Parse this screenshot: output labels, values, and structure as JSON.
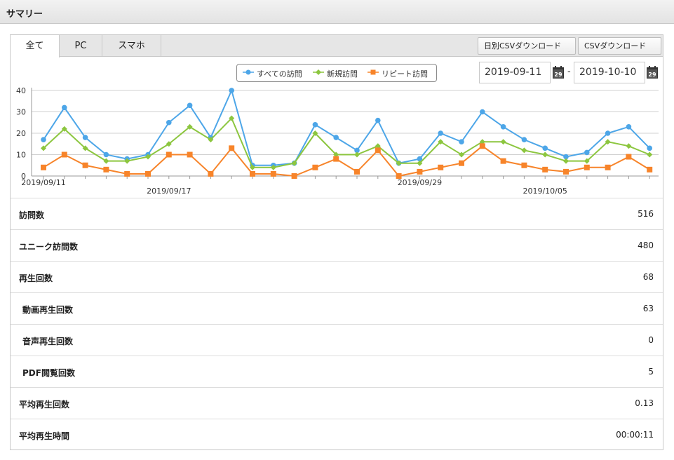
{
  "header": {
    "title": "サマリー"
  },
  "tabs": [
    {
      "label": "全て",
      "active": true
    },
    {
      "label": "PC",
      "active": false
    },
    {
      "label": "スマホ",
      "active": false
    }
  ],
  "buttons": {
    "daily_csv": "日別CSVダウンロード",
    "csv": "CSVダウンロード"
  },
  "date_range": {
    "start": "2019-09-11",
    "end": "2019-10-10",
    "separator": "-",
    "calendar_day": "29"
  },
  "chart_data": {
    "type": "line",
    "x": [
      "2019/09/11",
      "2019/09/12",
      "2019/09/13",
      "2019/09/14",
      "2019/09/15",
      "2019/09/16",
      "2019/09/17",
      "2019/09/18",
      "2019/09/19",
      "2019/09/20",
      "2019/09/21",
      "2019/09/22",
      "2019/09/23",
      "2019/09/24",
      "2019/09/25",
      "2019/09/26",
      "2019/09/27",
      "2019/09/28",
      "2019/09/29",
      "2019/09/30",
      "2019/10/01",
      "2019/10/02",
      "2019/10/03",
      "2019/10/04",
      "2019/10/05",
      "2019/10/06",
      "2019/10/07",
      "2019/10/08",
      "2019/10/09",
      "2019/10/10"
    ],
    "x_tick_labels": [
      "2019/09/11",
      "2019/09/17",
      "2019/09/29",
      "2019/10/05"
    ],
    "ylim": [
      0,
      40
    ],
    "y_ticks": [
      "0",
      "10",
      "20",
      "30",
      "40"
    ],
    "grid": true,
    "legend_position": "top-center",
    "series": [
      {
        "name": "すべての訪問",
        "color": "#4da6e8",
        "marker": "circle",
        "values": [
          17,
          32,
          18,
          10,
          8,
          10,
          25,
          33,
          18,
          40,
          5,
          5,
          6,
          24,
          18,
          12,
          26,
          6,
          8,
          20,
          16,
          30,
          23,
          17,
          13,
          9,
          11,
          20,
          23,
          13
        ]
      },
      {
        "name": "新規訪問",
        "color": "#8cc63f",
        "marker": "diamond",
        "values": [
          13,
          22,
          13,
          7,
          7,
          9,
          15,
          23,
          17,
          27,
          4,
          4,
          6,
          20,
          10,
          10,
          14,
          6,
          6,
          16,
          10,
          16,
          16,
          12,
          10,
          7,
          7,
          16,
          14,
          10
        ]
      },
      {
        "name": "リピート訪問",
        "color": "#f7842a",
        "marker": "square",
        "values": [
          4,
          10,
          5,
          3,
          1,
          1,
          10,
          10,
          1,
          13,
          1,
          1,
          0,
          4,
          8,
          2,
          12,
          0,
          2,
          4,
          6,
          14,
          7,
          5,
          3,
          2,
          4,
          4,
          9,
          3
        ]
      }
    ]
  },
  "stats": [
    {
      "label": "訪問数",
      "value": "516",
      "indent": false
    },
    {
      "label": "ユニーク訪問数",
      "value": "480",
      "indent": false
    },
    {
      "label": "再生回数",
      "value": "68",
      "indent": false
    },
    {
      "label": "動画再生回数",
      "value": "63",
      "indent": true
    },
    {
      "label": "音声再生回数",
      "value": "0",
      "indent": true
    },
    {
      "label": "PDF閲覧回数",
      "value": "5",
      "indent": true
    },
    {
      "label": "平均再生回数",
      "value": "0.13",
      "indent": false
    },
    {
      "label": "平均再生時間",
      "value": "00:00:11",
      "indent": false
    }
  ],
  "icons": {
    "calendar": "calendar-icon"
  }
}
